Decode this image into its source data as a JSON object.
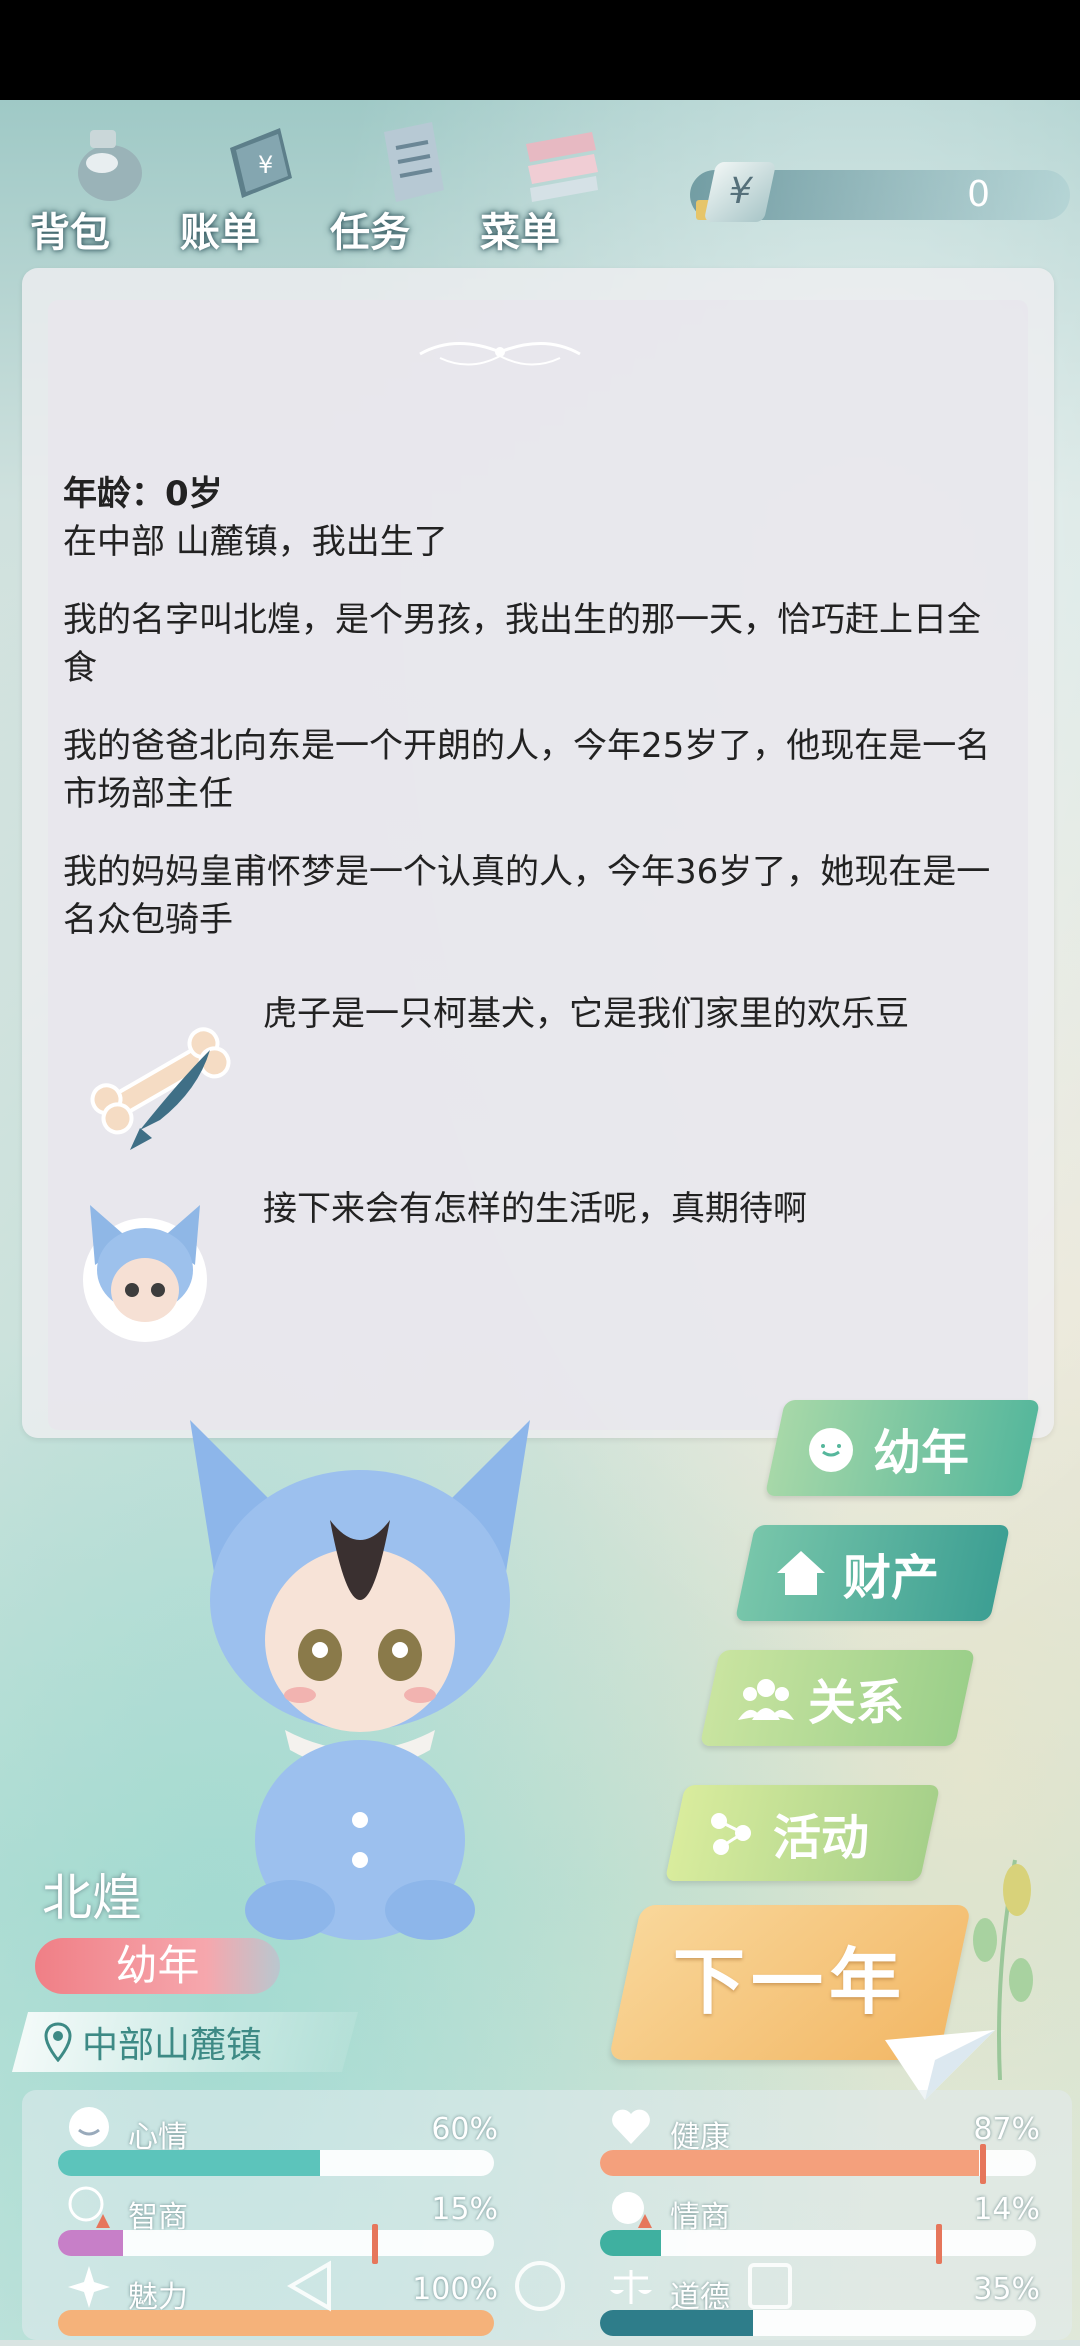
{
  "toolbar": {
    "bag_label": "背包",
    "bill_label": "账单",
    "tasks_label": "任务",
    "menu_label": "菜单"
  },
  "money": {
    "symbol": "¥",
    "amount": "0"
  },
  "story": {
    "age_line": "年龄：0岁",
    "born_line": "在中部 山麓镇，我出生了",
    "paragraphs": [
      "我的名字叫北煌，是个男孩，我出生的那一天，恰巧赶上日全食",
      "我的爸爸北向东是一个开朗的人，今年25岁了，他现在是一名市场部主任",
      "我的妈妈皇甫怀梦是一个认真的人，今年36岁了，她现在是一名众包骑手"
    ],
    "pet_line": "虎子是一只柯基犬，它是我们家里的欢乐豆",
    "ending_line": "接下来会有怎样的生活呢，真期待啊"
  },
  "menu": {
    "childhood_label": "幼年",
    "assets_label": "财产",
    "relations_label": "关系",
    "activities_label": "活动",
    "next_year_label": "下一年"
  },
  "player": {
    "name": "北煌",
    "stage": "幼年",
    "location": "中部山麓镇"
  },
  "stats": {
    "mood": {
      "label": "心情",
      "value": "60%",
      "fill": 0.6,
      "color": "#5cc4bb"
    },
    "health": {
      "label": "健康",
      "value": "87%",
      "fill": 0.87,
      "color": "#f4a07c"
    },
    "iq": {
      "label": "智商",
      "value": "15%",
      "fill": 0.15,
      "color": "#c77fc8"
    },
    "eq": {
      "label": "情商",
      "value": "14%",
      "fill": 0.14,
      "color": "#3fb0a0"
    },
    "charm": {
      "label": "魅力",
      "value": "100%",
      "fill": 1.0,
      "color": "#f5b27a"
    },
    "morality": {
      "label": "道德",
      "value": "35%",
      "fill": 0.35,
      "color": "#2e7d8a"
    }
  },
  "colors": {
    "accent_teal": "#3d9f93",
    "stage_red": "#f07f86",
    "next_orange": "#f2b765"
  }
}
